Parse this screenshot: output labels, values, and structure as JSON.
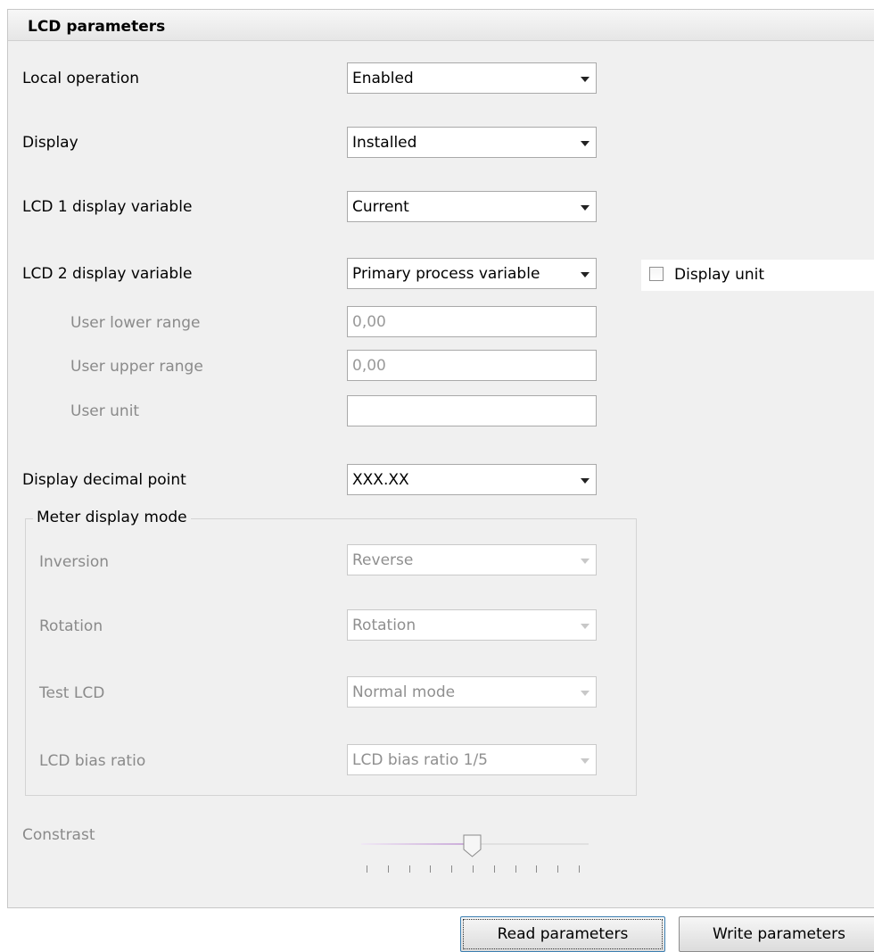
{
  "panel": {
    "title": "LCD parameters"
  },
  "rows": {
    "local_operation": {
      "label": "Local operation",
      "value": "Enabled"
    },
    "display": {
      "label": "Display",
      "value": "Installed"
    },
    "lcd1": {
      "label": "LCD 1 display variable",
      "value": "Current"
    },
    "lcd2": {
      "label": "LCD 2 display variable",
      "value": "Primary process variable"
    },
    "user_lower": {
      "label": "User lower range",
      "value": "0,00"
    },
    "user_upper": {
      "label": "User upper range",
      "value": "0,00"
    },
    "user_unit": {
      "label": "User unit",
      "value": ""
    },
    "decimal_point": {
      "label": "Display decimal point",
      "value": "XXX.XX"
    }
  },
  "display_unit": {
    "label": "Display unit",
    "checked": false
  },
  "meter_display_mode": {
    "title": "Meter display mode",
    "inversion": {
      "label": "Inversion",
      "value": "Reverse"
    },
    "rotation": {
      "label": "Rotation",
      "value": "Rotation"
    },
    "test_lcd": {
      "label": "Test LCD",
      "value": "Normal mode"
    },
    "bias_ratio": {
      "label": "LCD bias ratio",
      "value": "LCD bias ratio 1/5"
    }
  },
  "contrast": {
    "label": "Constrast",
    "tick_count": 11,
    "level_fraction": 0.5
  },
  "buttons": {
    "read": "Read parameters",
    "write": "Write parameters"
  },
  "colors": {
    "panel_bg": "#f0f0f0",
    "disabled_text": "#8a8a8a",
    "slider_fill": "#c9a9d8"
  }
}
